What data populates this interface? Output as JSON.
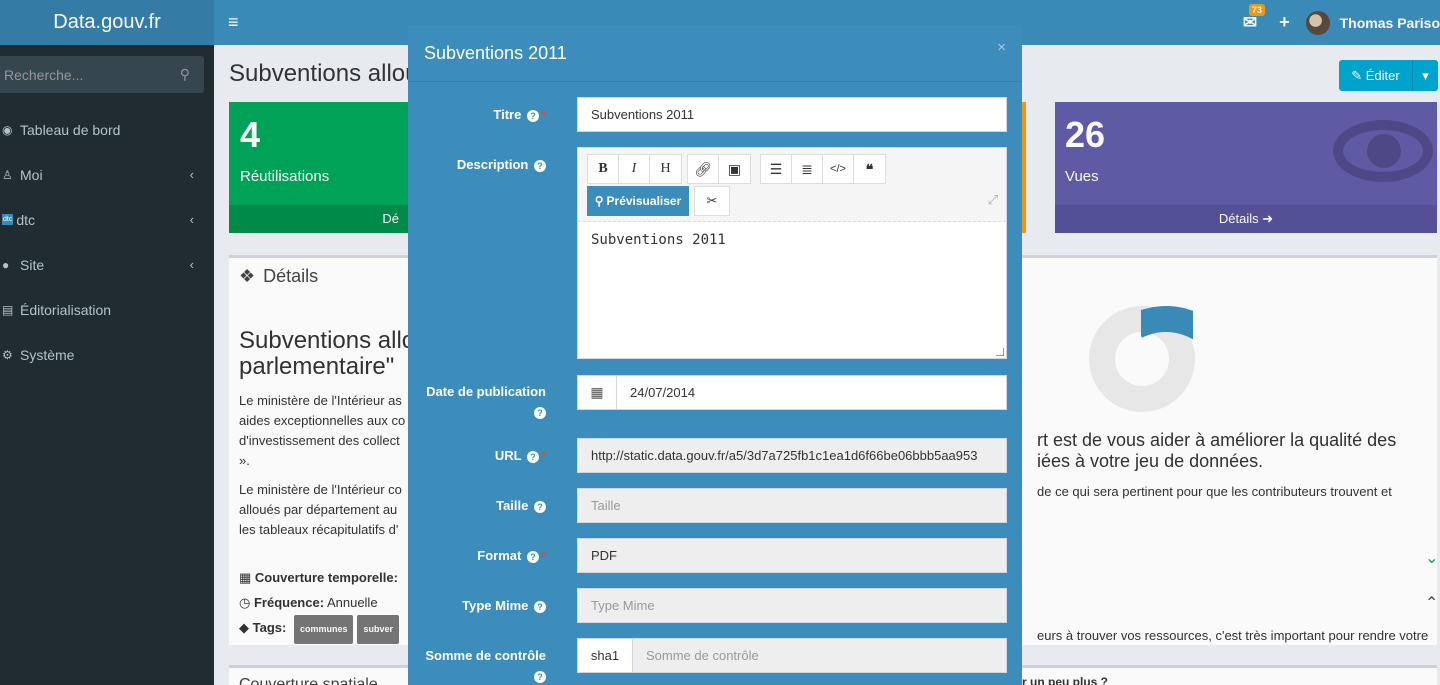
{
  "header": {
    "logo": "Data.gouv.fr",
    "notification_count": "73",
    "user_name": "Thomas Pariso"
  },
  "sidebar": {
    "search_placeholder": "Recherche...",
    "items": [
      {
        "label": "Tableau de bord",
        "icon": "dashboard-icon"
      },
      {
        "label": "Moi",
        "icon": "male-icon"
      },
      {
        "label": "dtc",
        "icon": "dtc-badge",
        "badge": "dtc"
      },
      {
        "label": "Site",
        "icon": "globe-icon"
      },
      {
        "label": "Éditorialisation",
        "icon": "newspaper-icon"
      },
      {
        "label": "Système",
        "icon": "cogs-icon"
      }
    ]
  },
  "content": {
    "page_title": "Subventions allou",
    "edit_label": "Éditer",
    "stats": {
      "reuses_count": "4",
      "reuses_label": "Réutilisations",
      "reuses_footer": "Dé",
      "views_count": "26",
      "views_label": "Vues",
      "views_footer": "Détails"
    },
    "details": {
      "heading": "Détails",
      "title": "Subventions allo parlementaire\"",
      "desc_1": "Le ministère de l'Intérieur as aides exceptionnelles aux co d'investissement des collect ».",
      "desc_2": "Le ministère de l'Intérieur co alloués par département au les tableaux récapitulatifs d'",
      "coverage_label": "Couverture temporelle:",
      "frequency_label": "Fréquence:",
      "frequency_value": "Annuelle",
      "tags_label": "Tags:",
      "tags": [
        "communes",
        "subver"
      ],
      "right_heading": "rt est de vous aider à améliorer la qualité des iées à votre jeu de données.",
      "right_text": "de ce qui sera pertinent pour que les contributeurs trouvent et",
      "right_text_2": "eurs à trouver vos ressources, c'est très important pour rendre votre",
      "right_link": "r un peu plus ?"
    },
    "footer_box": "Couverture spatiale"
  },
  "modal": {
    "title": "Subventions 2011",
    "close": "×",
    "fields": {
      "title_label": "Titre",
      "title_value": "Subventions 2011",
      "description_label": "Description",
      "description_value": "Subventions 2011",
      "preview_label": "Prévisualiser",
      "date_label": "Date de publication",
      "date_value": "24/07/2014",
      "url_label": "URL",
      "url_value": "http://static.data.gouv.fr/a5/3d7a725fb1c1ea1d6f66be06bbb5aa953",
      "size_label": "Taille",
      "size_placeholder": "Taille",
      "format_label": "Format",
      "format_value": "PDF",
      "mime_label": "Type Mime",
      "mime_placeholder": "Type Mime",
      "checksum_label": "Somme de contrôle",
      "checksum_type": "sha1",
      "checksum_placeholder": "Somme de contrôle"
    }
  }
}
